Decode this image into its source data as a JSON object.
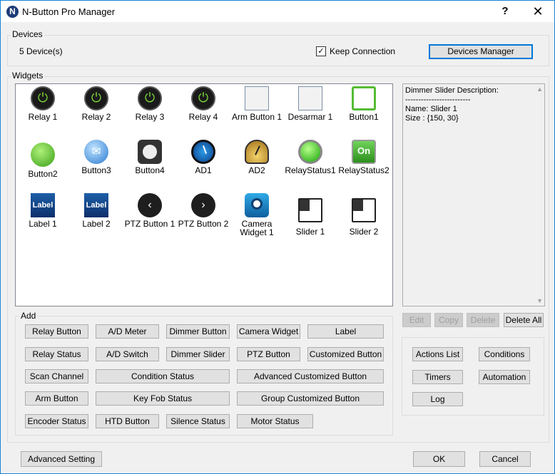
{
  "window": {
    "title": "N-Button Pro Manager",
    "icon": "N",
    "help": "?",
    "close": "✕"
  },
  "devices": {
    "group_label": "Devices",
    "count_text": "5 Device(s)",
    "keep_connection_label": "Keep Connection",
    "keep_connection_checked": true,
    "manager_button": "Devices Manager"
  },
  "widgets": {
    "group_label": "Widgets",
    "items": [
      {
        "label": "Relay 1",
        "icon": "power-icon"
      },
      {
        "label": "Relay 2",
        "icon": "power-icon"
      },
      {
        "label": "Relay 3",
        "icon": "power-icon"
      },
      {
        "label": "Relay 4",
        "icon": "power-icon"
      },
      {
        "label": "Arm Button 1",
        "icon": "square-button-icon"
      },
      {
        "label": "Desarmar 1",
        "icon": "square-button-icon"
      },
      {
        "label": "Button1",
        "icon": "green-square-button-icon"
      },
      {
        "label": "Button2",
        "icon": "green-ellipse-button-icon"
      },
      {
        "label": "Button3",
        "icon": "mail-button-icon"
      },
      {
        "label": "Button4",
        "icon": "round-button-icon"
      },
      {
        "label": "AD1",
        "icon": "blue-gauge-icon"
      },
      {
        "label": "AD2",
        "icon": "gold-gauge-icon"
      },
      {
        "label": "RelayStatus1",
        "icon": "green-led-icon"
      },
      {
        "label": "RelayStatus2",
        "icon": "on-switch-icon"
      },
      {
        "label": "Label 1",
        "icon": "label-icon"
      },
      {
        "label": "Label 2",
        "icon": "label-icon"
      },
      {
        "label": "PTZ Button 1",
        "icon": "ptz-left-icon"
      },
      {
        "label": "PTZ Button 2",
        "icon": "ptz-right-icon"
      },
      {
        "label": "Camera Widget 1",
        "icon": "camera-icon"
      },
      {
        "label": "Slider 1",
        "icon": "slider-icon"
      },
      {
        "label": "Slider 2",
        "icon": "slider-icon"
      }
    ],
    "icon_text": {
      "on": "On",
      "label": "Label",
      "left": "‹",
      "right": "›"
    }
  },
  "description": {
    "text": "Dimmer Slider Description:\n-------------------------\nName: Slider 1\nSize : {150, 30}"
  },
  "desc_buttons": {
    "edit": "Edit",
    "copy": "Copy",
    "delete": "Delete",
    "delete_all": "Delete All"
  },
  "add": {
    "group_label": "Add",
    "relay_button": "Relay Button",
    "ad_meter": "A/D Meter",
    "dimmer_button": "Dimmer Button",
    "camera_widget": "Camera Widget",
    "label": "Label",
    "relay_status": "Relay Status",
    "ad_switch": "A/D Switch",
    "dimmer_slider": "Dimmer Slider",
    "ptz_button": "PTZ Button",
    "customized_button": "Customized Button",
    "scan_channel": "Scan Channel",
    "condition_status": "Condition Status",
    "advanced_customized_button": "Advanced Customized Button",
    "arm_button": "Arm Button",
    "key_fob_status": "Key Fob Status",
    "group_customized_button": "Group Customized Button",
    "encoder_status": "Encoder Status",
    "htd_button": "HTD Button",
    "silence_status": "Silence Status",
    "motor_status": "Motor Status"
  },
  "side_buttons": {
    "actions_list": "Actions List",
    "conditions": "Conditions",
    "timers": "Timers",
    "automation": "Automation",
    "log": "Log"
  },
  "footer": {
    "advanced_setting": "Advanced Setting",
    "ok": "OK",
    "cancel": "Cancel"
  }
}
